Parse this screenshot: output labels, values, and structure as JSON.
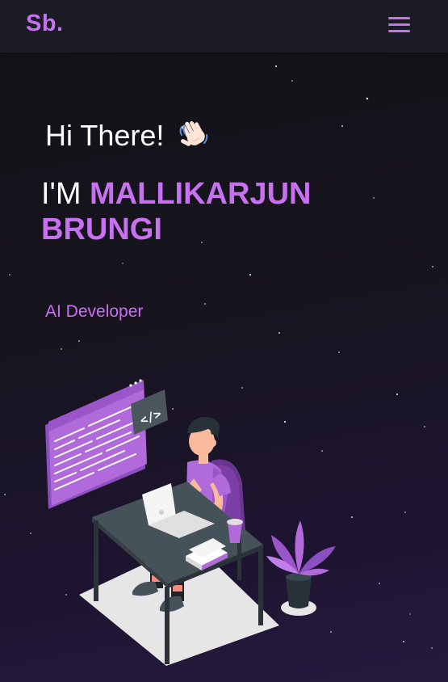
{
  "navbar": {
    "logo": "Sb.",
    "menu_icon": "hamburger-menu-icon"
  },
  "hero": {
    "greeting": "Hi There!",
    "greeting_icon": "waving-hand-icon",
    "name_prefix": "I'M ",
    "name": "MALLIKARJUN BRUNGI",
    "role": "AI Developer",
    "illustration": "developer-at-desk-illustration"
  },
  "colors": {
    "accent": "#c770f0",
    "navbar_bg": "#1a1b24",
    "page_bg": "#16151c",
    "text": "#ffffff"
  }
}
